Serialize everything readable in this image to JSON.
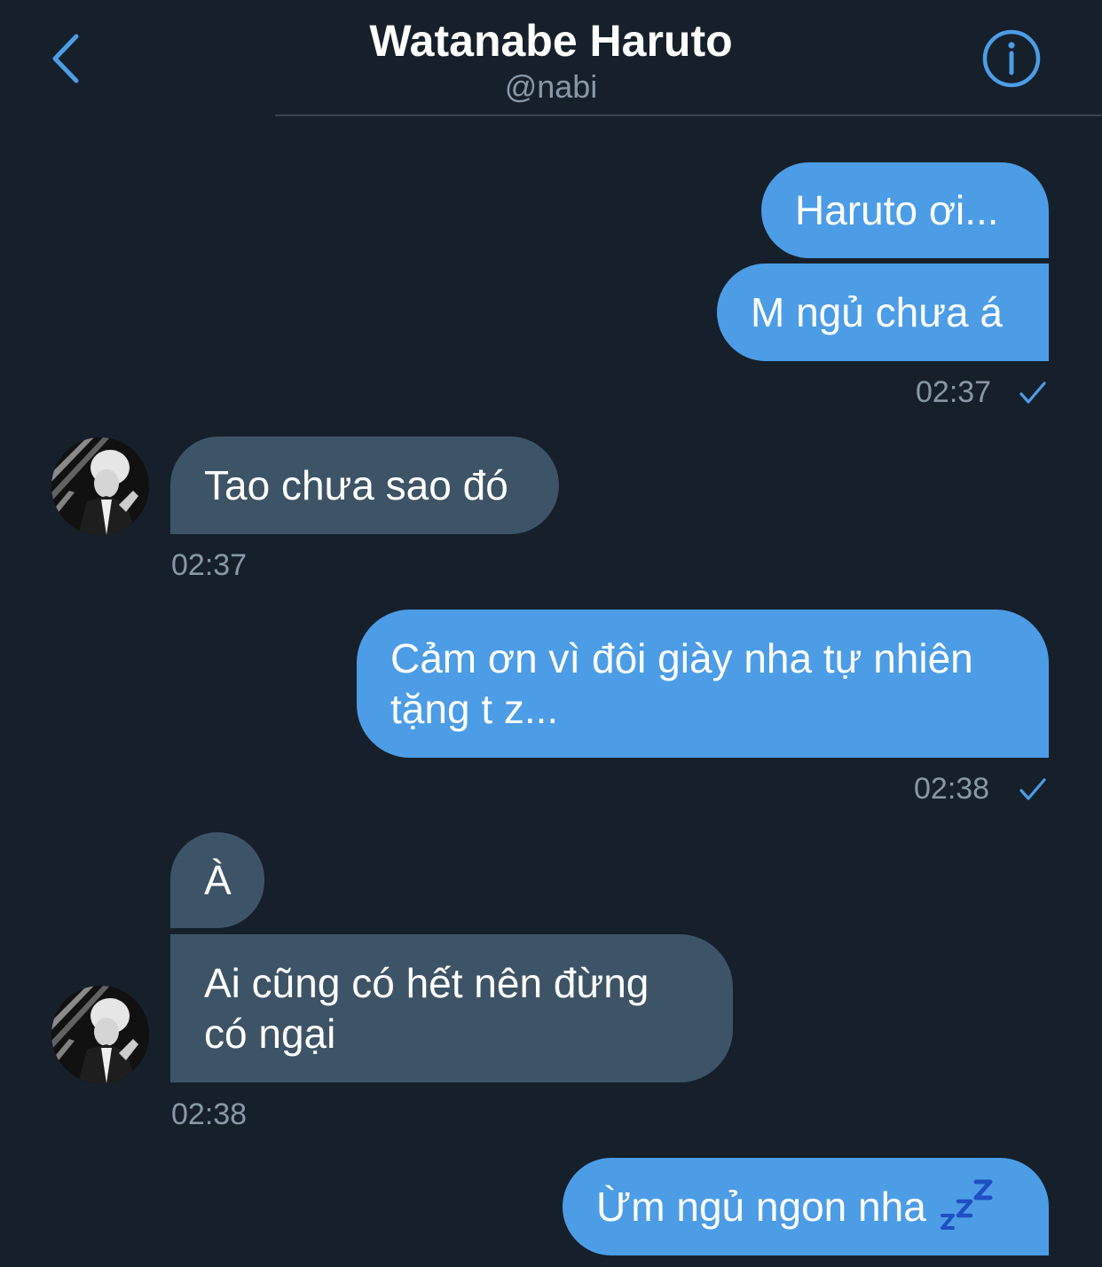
{
  "header": {
    "title": "Watanabe Haruto",
    "handle": "@nabi",
    "back_icon": "chevron-left-icon",
    "info_icon": "info-icon"
  },
  "colors": {
    "background": "#15202b",
    "accent": "#4c9de6",
    "incoming_bubble": "#3d5466",
    "muted_text": "#8899a6"
  },
  "messages": [
    {
      "direction": "out",
      "text": "Haruto ơi..."
    },
    {
      "direction": "out",
      "text": "M ngủ chưa á",
      "time": "02:37",
      "read": true
    },
    {
      "direction": "in",
      "text": "Tao chưa sao đó",
      "time": "02:37"
    },
    {
      "direction": "out",
      "text": "Cảm ơn vì đôi giày nha tự nhiên tặng t z...",
      "time": "02:38",
      "read": true
    },
    {
      "direction": "in",
      "text": "À"
    },
    {
      "direction": "in",
      "text": "Ai cũng có hết nên đừng có ngại",
      "time": "02:38"
    },
    {
      "direction": "out",
      "text": "Ừm ngủ ngon nha",
      "emoji": "sleeping-zzz-icon"
    }
  ]
}
